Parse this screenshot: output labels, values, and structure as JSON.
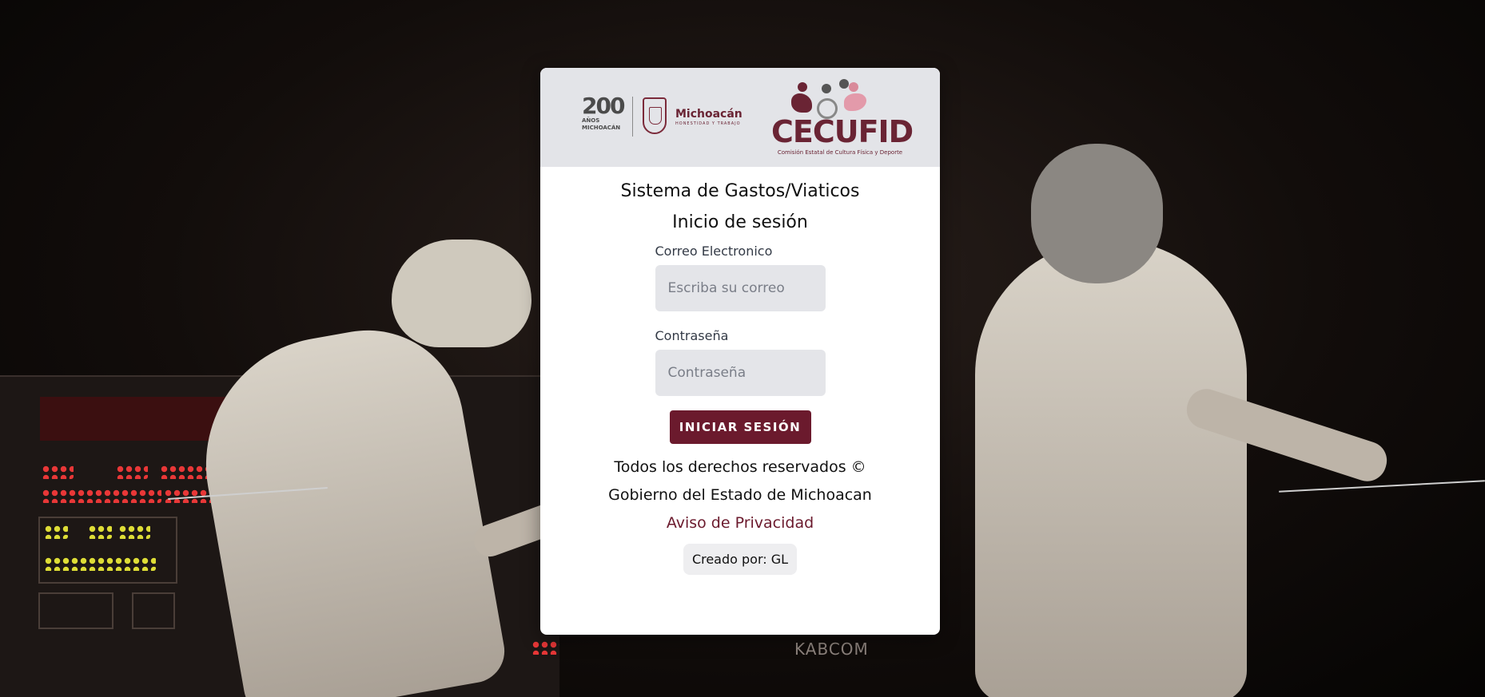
{
  "header": {
    "logo_200_number": "200",
    "logo_200_anos": "AÑOS",
    "logo_200_state": "MICHOACÁN",
    "michoacan_name": "Michoacán",
    "michoacan_tagline": "HONESTIDAD Y TRABAJO",
    "cecufid_name": "CECUFID",
    "cecufid_full": "Comisión Estatal de Cultura Física y Deporte"
  },
  "system_title": "Sistema de Gastos/Viaticos",
  "login_title": "Inicio de sesión",
  "form": {
    "email_label": "Correo Electronico",
    "email_placeholder": "Escriba su correo",
    "email_value": "",
    "password_label": "Contraseña",
    "password_placeholder": "Contraseña",
    "password_value": "",
    "submit_label": "INICIAR SESIÓN"
  },
  "footer": {
    "rights_line": "Todos los derechos reservados ©",
    "government_line": "Gobierno del Estado de Michoacan",
    "privacy_link": "Aviso de Privacidad",
    "creator": "Creado por: GL"
  },
  "background": {
    "scoreboard_brand": "KABCOM"
  },
  "colors": {
    "brand": "#6b1a2d",
    "header_bg": "#e3e4e8",
    "input_bg": "#e4e5e9"
  }
}
